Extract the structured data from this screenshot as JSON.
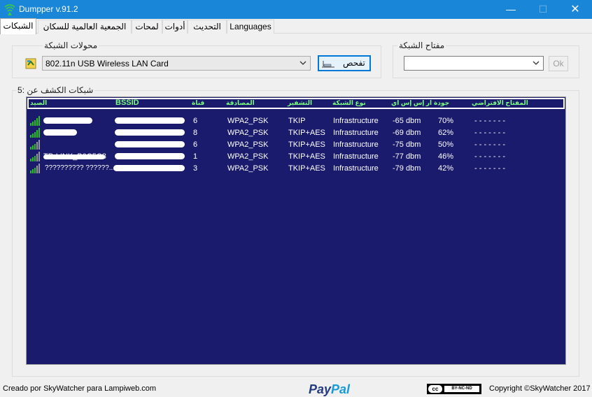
{
  "window": {
    "title": "Dumpper v.91.2",
    "min_glyph": "—",
    "max_glyph": "☐",
    "close_glyph": "✕"
  },
  "tabs": [
    {
      "label": "الشبكات",
      "active": true
    },
    {
      "label": "الجمعية العالمية للسكان",
      "active": false
    },
    {
      "label": "لمحات",
      "active": false
    },
    {
      "label": "أدوات",
      "active": false
    },
    {
      "label": "التحديث",
      "active": false
    },
    {
      "label": "Languages",
      "active": false
    }
  ],
  "adapters": {
    "legend": "محولات الشبكة",
    "selected": "802.11n USB Wireless LAN Card",
    "scan_button": "تفحص"
  },
  "network_key": {
    "legend": "مفتاح الشبكة",
    "selected": "",
    "ok_button": "Ok"
  },
  "networks": {
    "legend": "شبكات الكشف عن :5",
    "columns": {
      "ssid": "الصيد",
      "bssid": "BSSID",
      "channel": "قناة",
      "auth": "المصادقة",
      "encryption": "التشفير",
      "network_type": "نوع الشبكة",
      "rssi": "ار إس إس اي",
      "quality": "جودة",
      "default_key": "المفتاح الافتراضي"
    },
    "rows": [
      {
        "ssid": "",
        "channel": "6",
        "auth": "WPA2_PSK",
        "encryption": "TKIP",
        "network_type": "Infrastructure",
        "rssi": "-65 dbm",
        "quality": "70%",
        "default_key": "- - - - - - -",
        "signal": 5
      },
      {
        "ssid": "",
        "channel": "8",
        "auth": "WPA2_PSK",
        "encryption": "TKIP+AES",
        "network_type": "Infrastructure",
        "rssi": "-69 dbm",
        "quality": "62%",
        "default_key": "- - - - - - -",
        "signal": 4
      },
      {
        "ssid": "",
        "channel": "6",
        "auth": "WPA2_PSK",
        "encryption": "TKIP+AES",
        "network_type": "Infrastructure",
        "rssi": "-75 dbm",
        "quality": "50%",
        "default_key": "- - - - - - -",
        "signal": 3
      },
      {
        "ssid": "TP-LINK_B0C5C8",
        "channel": "1",
        "auth": "WPA2_PSK",
        "encryption": "TKIP+AES",
        "network_type": "Infrastructure",
        "rssi": "-77 dbm",
        "quality": "46%",
        "default_key": "- - - - - - -",
        "signal": 3
      },
      {
        "ssid": "?????????? ??????...",
        "channel": "3",
        "auth": "WPA2_PSK",
        "encryption": "TKIP+AES",
        "network_type": "Infrastructure",
        "rssi": "-79 dbm",
        "quality": "42%",
        "default_key": "- - - - - - -",
        "signal": 3
      }
    ]
  },
  "statusbar": {
    "credit": "Creado por SkyWatcher para Lampiweb.com",
    "paypal_pay": "Pay",
    "paypal_pal": "Pal",
    "cc_label": "cc",
    "license": "BY-NC-ND",
    "copyright": "Copyright ©SkyWatcher 2017"
  },
  "colors": {
    "titlebar": "#1a86d7",
    "list_background": "#1b1b6e",
    "header_text": "#7dff7d",
    "signal_green": "#22c322"
  }
}
